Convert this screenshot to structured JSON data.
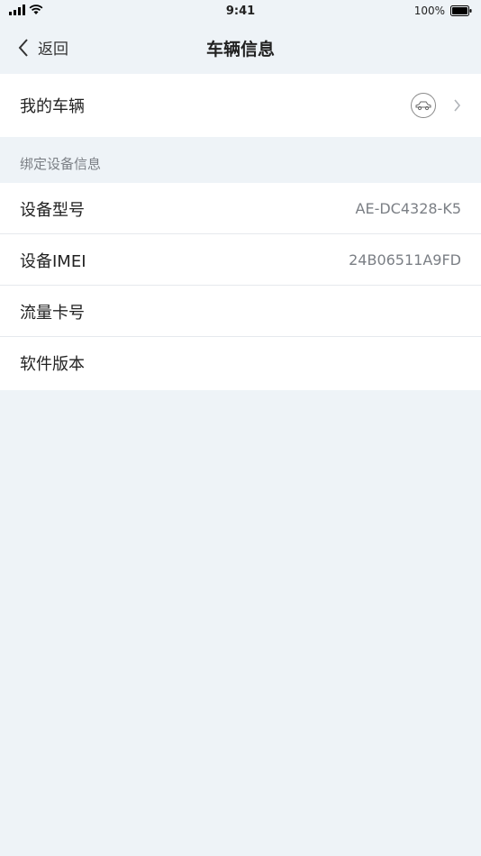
{
  "status_bar": {
    "time": "9:41",
    "battery": "100%"
  },
  "nav": {
    "back_label": "返回",
    "title": "车辆信息"
  },
  "vehicle": {
    "label": "我的车辆"
  },
  "device_section": {
    "header": "绑定设备信息",
    "items": [
      {
        "label": "设备型号",
        "value": "AE-DC4328-K5"
      },
      {
        "label": "设备IMEI",
        "value": "24B06511A9FD"
      },
      {
        "label": "流量卡号",
        "value": ""
      },
      {
        "label": "软件版本",
        "value": ""
      }
    ]
  },
  "colors": {
    "background": "#eef3f7",
    "card": "#ffffff",
    "muted_text": "#7b7f85"
  }
}
